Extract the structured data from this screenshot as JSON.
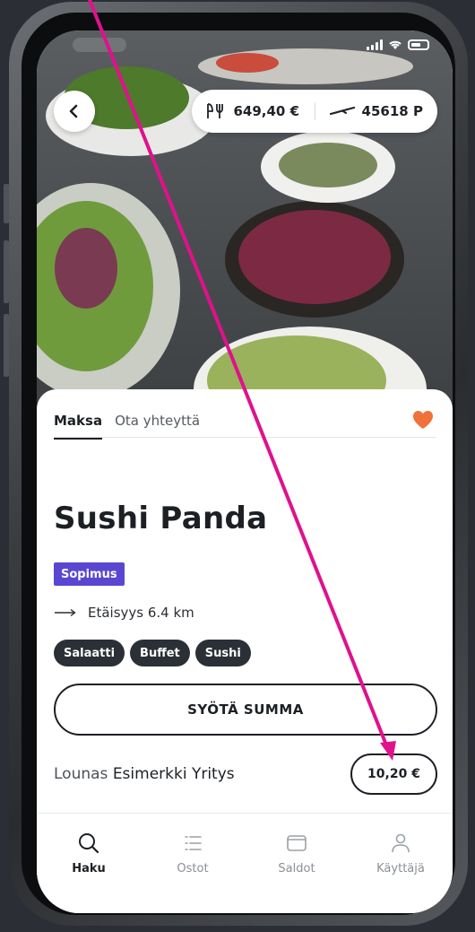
{
  "header": {
    "meals_value": "649,40 €",
    "points_value": "45618 P"
  },
  "tabs": [
    {
      "label": "Maksa",
      "active": true
    },
    {
      "label": "Ota yhteyttä",
      "active": false
    }
  ],
  "restaurant": {
    "name": "Sushi Panda",
    "badge": "Sopimus",
    "distance": "Etäisyys 6.4 km",
    "tags": [
      "Salaatti",
      "Buffet",
      "Sushi"
    ]
  },
  "actions": {
    "enter_amount_label": "SYÖTÄ SUMMA",
    "lunch_prefix": "Lounas",
    "lunch_company": "Esimerkki Yritys",
    "lunch_price": "10,20 €"
  },
  "navbar": {
    "items": [
      {
        "label": "Haku",
        "icon": "search-icon",
        "active": true
      },
      {
        "label": "Ostot",
        "icon": "list-icon",
        "active": false
      },
      {
        "label": "Saldot",
        "icon": "wallet-icon",
        "active": false
      },
      {
        "label": "Käyttäjä",
        "icon": "user-icon",
        "active": false
      }
    ]
  },
  "colors": {
    "accent_badge": "#5a47d1",
    "heart": "#f0713a",
    "annotation_arrow": "#e0118c"
  }
}
